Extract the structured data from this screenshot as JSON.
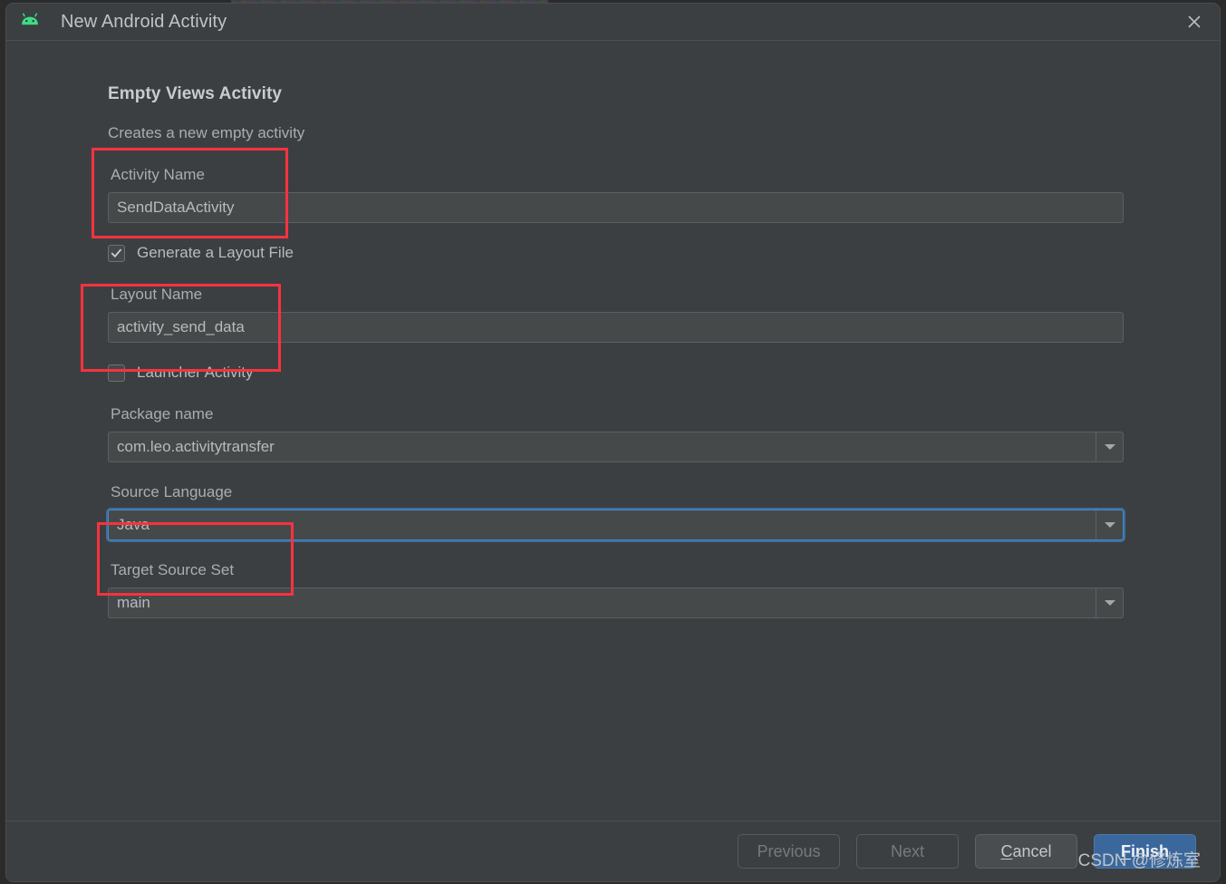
{
  "window": {
    "title": "New Android Activity",
    "icon": "android-robot-icon",
    "close_icon": "close-icon"
  },
  "main": {
    "heading": "Empty Views Activity",
    "description": "Creates a new empty activity",
    "fields": {
      "activity_name": {
        "label": "Activity Name",
        "value": "SendDataActivity"
      },
      "generate_layout": {
        "label": "Generate a Layout File",
        "checked": true
      },
      "layout_name": {
        "label": "Layout Name",
        "value": "activity_send_data"
      },
      "launcher_activity": {
        "label": "Launcher Activity",
        "checked": false
      },
      "package_name": {
        "label": "Package name",
        "value": "com.leo.activitytransfer"
      },
      "source_language": {
        "label": "Source Language",
        "value": "Java"
      },
      "target_source_set": {
        "label": "Target Source Set",
        "value": "main"
      }
    }
  },
  "footer": {
    "previous": "Previous",
    "next": "Next",
    "cancel_mnemonic": "C",
    "cancel_rest": "ancel",
    "finish_mnemonic": "F",
    "finish_rest": "inish"
  },
  "overlay": {
    "watermark": "CSDN @修炼室",
    "annotation_color": "#f5333f"
  },
  "colors": {
    "dialog_bg": "#3c3f41",
    "field_bg": "#45494a",
    "accent_blue": "#3b689c",
    "focus_blue": "#4a88c7",
    "android_green": "#3ddc84",
    "text": "#b7bbbf"
  }
}
